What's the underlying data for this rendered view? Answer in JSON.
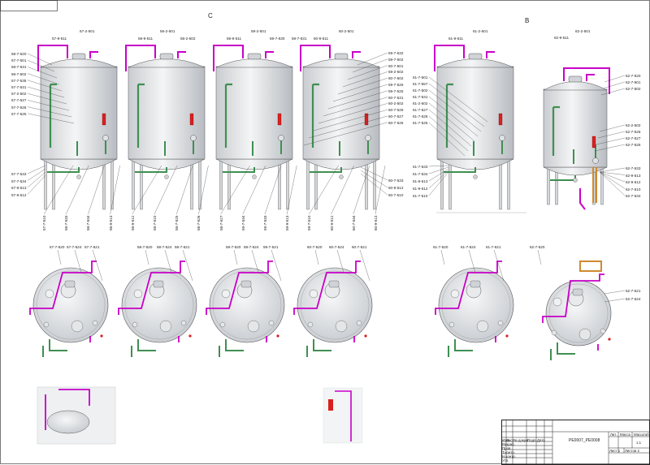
{
  "sections": {
    "left": "C",
    "right": "B"
  },
  "title_block": {
    "designation": "PE0007_PE0008",
    "scale": "1:1",
    "sheet": "Лист 1",
    "sheets": "Листов 2",
    "col_izm": "Изм",
    "col_list": "Лист",
    "col_doc": "№ докум.",
    "col_sign": "Подп.",
    "col_date": "Дата",
    "row_razrab": "Разраб.",
    "row_prov": "Пров.",
    "row_tkontr": "Т.контр.",
    "row_nkontr": "Н.контр.",
    "row_utv": "Утв.",
    "col_lit": "Лит.",
    "col_mass": "Масса",
    "col_scale": "Масштаб"
  },
  "top_tanks": [
    {
      "id": "t57",
      "top_labels": [
        "57-9-511",
        "57-2-501"
      ],
      "left_labels": [
        "58-7-520",
        "57-7-501",
        "58-7-531",
        "58-7-502",
        "57-7-535",
        "57-7-531",
        "57-2-502",
        "57-7-527",
        "57-7-526",
        "57-7-525"
      ],
      "left_bottom": [
        "57-7-533",
        "57-7-534",
        "57-9-513",
        "57-9-512"
      ],
      "bottom_labels": [
        "57-7-510",
        "58-7-533",
        "58-7-534",
        "58-9-513",
        "58-9-512",
        "58-7-510",
        "58-7-525",
        "58-7-526"
      ]
    },
    {
      "id": "t58",
      "top_labels": [
        "58-9-511",
        "58-2-501",
        "58-2-502"
      ],
      "left_labels": [],
      "left_bottom": [],
      "bottom_labels": []
    },
    {
      "id": "t59",
      "top_labels": [
        "59-9-511",
        "59-2-501",
        "59-7-530",
        "59-7-531"
      ],
      "left_labels": [],
      "left_bottom": [],
      "bottom_labels": [
        "58-7-527",
        "59-7-534",
        "59-7-533",
        "59-9-513",
        "59-7-510",
        "60-9-512",
        "60-7-534",
        "60-9-513"
      ]
    },
    {
      "id": "t60",
      "top_labels": [
        "60-9-511",
        "60-2-501"
      ],
      "left_labels": [],
      "left_bottom": [],
      "right_labels": [
        "59-7-532",
        "59-7-502",
        "60-7-501",
        "59-2-502",
        "60-7-502",
        "59-7-526",
        "59-7-525",
        "60-7-531",
        "60-2-502",
        "60-7-526",
        "60-7-527",
        "60-7-525"
      ],
      "right_bottom": [
        "60-7-533",
        "60-9-512",
        "60-7-510"
      ]
    }
  ],
  "right_tanks": [
    {
      "id": "t61",
      "top_labels": [
        "61-9-511",
        "61-2-501"
      ],
      "left_labels": [
        "61-7-501",
        "61-7-557",
        "61-7-502",
        "61-7-531",
        "61-2-502",
        "61-7-527",
        "61-7-526",
        "61-7-525"
      ],
      "left_bottom": [
        "61-7-533",
        "61-7-534",
        "61-9-513",
        "61-9-512",
        "61-7-510"
      ]
    },
    {
      "id": "t62",
      "top_labels": [
        "62-9-511",
        "62-2-501"
      ],
      "right_labels": [
        "62-7-520",
        "62-7-501",
        "62-7-502",
        "62-2-502",
        "62-7-526",
        "62-7-527",
        "62-7-525"
      ],
      "right_bottom": [
        "62-7-533",
        "62-9-513",
        "62-9-512",
        "62-7-510",
        "62-7-534"
      ]
    }
  ],
  "plan_views": [
    {
      "id": "p57",
      "labels": [
        "57-7-520",
        "57-7-524",
        "57-7-521"
      ]
    },
    {
      "id": "p58",
      "labels": [
        "58-7-520",
        "58-7-524",
        "58-7-521"
      ]
    },
    {
      "id": "p59",
      "labels": [
        "59-7-520",
        "59-7-524",
        "59-7-521"
      ]
    },
    {
      "id": "p60",
      "labels": [
        "60-7-520",
        "60-7-524",
        "60-7-521"
      ]
    },
    {
      "id": "p61",
      "labels": [
        "61-7-520",
        "61-7-524",
        "61-7-521"
      ]
    },
    {
      "id": "p62",
      "labels": [
        "62-7-520",
        "62-7-521",
        "62-7-524"
      ]
    }
  ],
  "colors": {
    "co2_pipe": "#c800c8",
    "glycol_pipe": "#3f8f52",
    "sensor": "#d92020",
    "tank_shell": "#e6e8ea",
    "tank_outline": "#555555",
    "copper": "#d08a30"
  }
}
